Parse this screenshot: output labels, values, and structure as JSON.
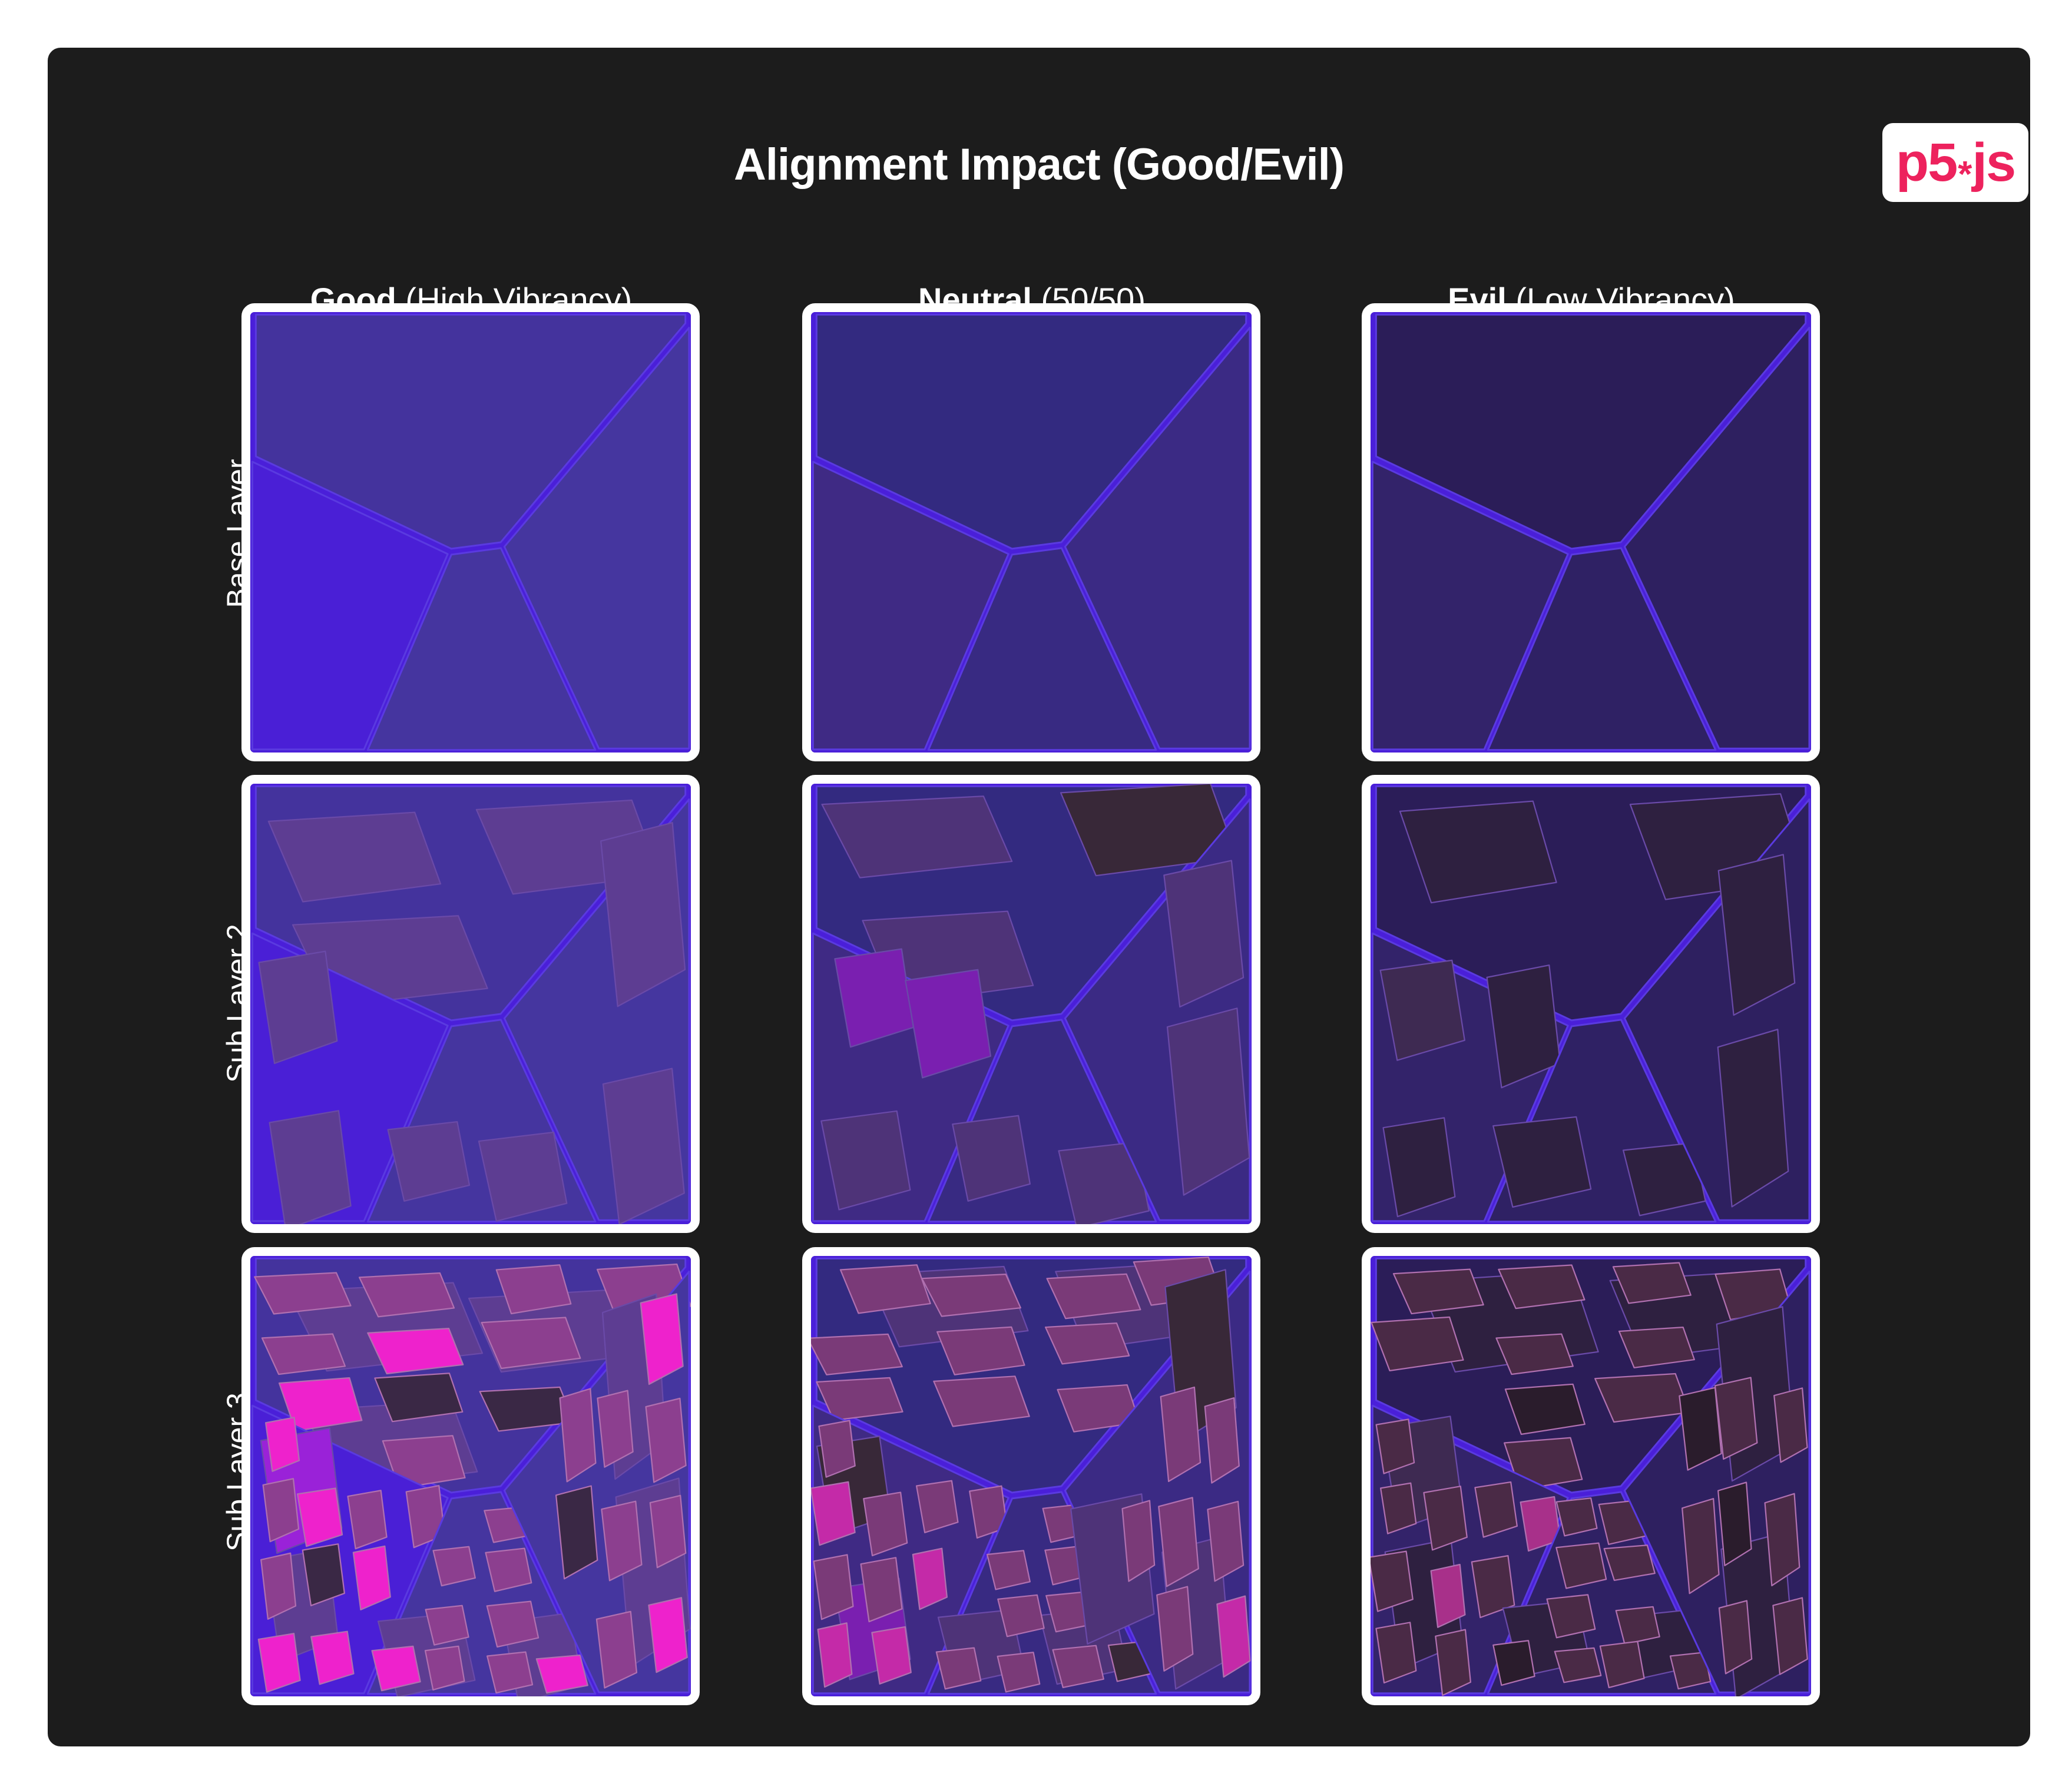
{
  "title": "Alignment Impact (Good/Evil)",
  "logo": {
    "left": "p5",
    "mid": "*",
    "right": "js",
    "color": "#ed225d"
  },
  "columns": [
    {
      "bold": "Good",
      "rest": " (High Vibrancy)"
    },
    {
      "bold": "Neutral",
      "rest": " (50/50)"
    },
    {
      "bold": "Evil",
      "rest": " (Low Vibrancy)"
    }
  ],
  "rows": [
    "Base Layer",
    "Sub Layer 2",
    "Sub Layer 3"
  ],
  "palette": {
    "background": "#1c1c1c",
    "seam": "#4a1fd9",
    "good": {
      "base": [
        "#44339d",
        "#4a1fd6",
        "#45359f",
        "#45369f"
      ],
      "sub2": "#5d3d92",
      "sub2_hi": "#9a22d8",
      "sub3": "#8c3f8f",
      "sub3_hi": "#ee22cc",
      "dark": "#3a2845"
    },
    "neutral": {
      "base": [
        "#332a80",
        "#3f2a84",
        "#382a82",
        "#3b2a84"
      ],
      "sub2": "#4e3378",
      "sub2_hi": "#7a1fb0",
      "sub3": "#7a3a78",
      "sub3_hi": "#c42aa8",
      "dark": "#382838"
    },
    "evil": {
      "base": [
        "#2b1d58",
        "#33236a",
        "#2f2164",
        "#2e2060"
      ],
      "sub2": "#2e2040",
      "sub2_hi": "#3e2a52",
      "sub3": "#4a2a46",
      "sub3_hi": "#a8308a",
      "dark": "#2a1c2c"
    }
  }
}
